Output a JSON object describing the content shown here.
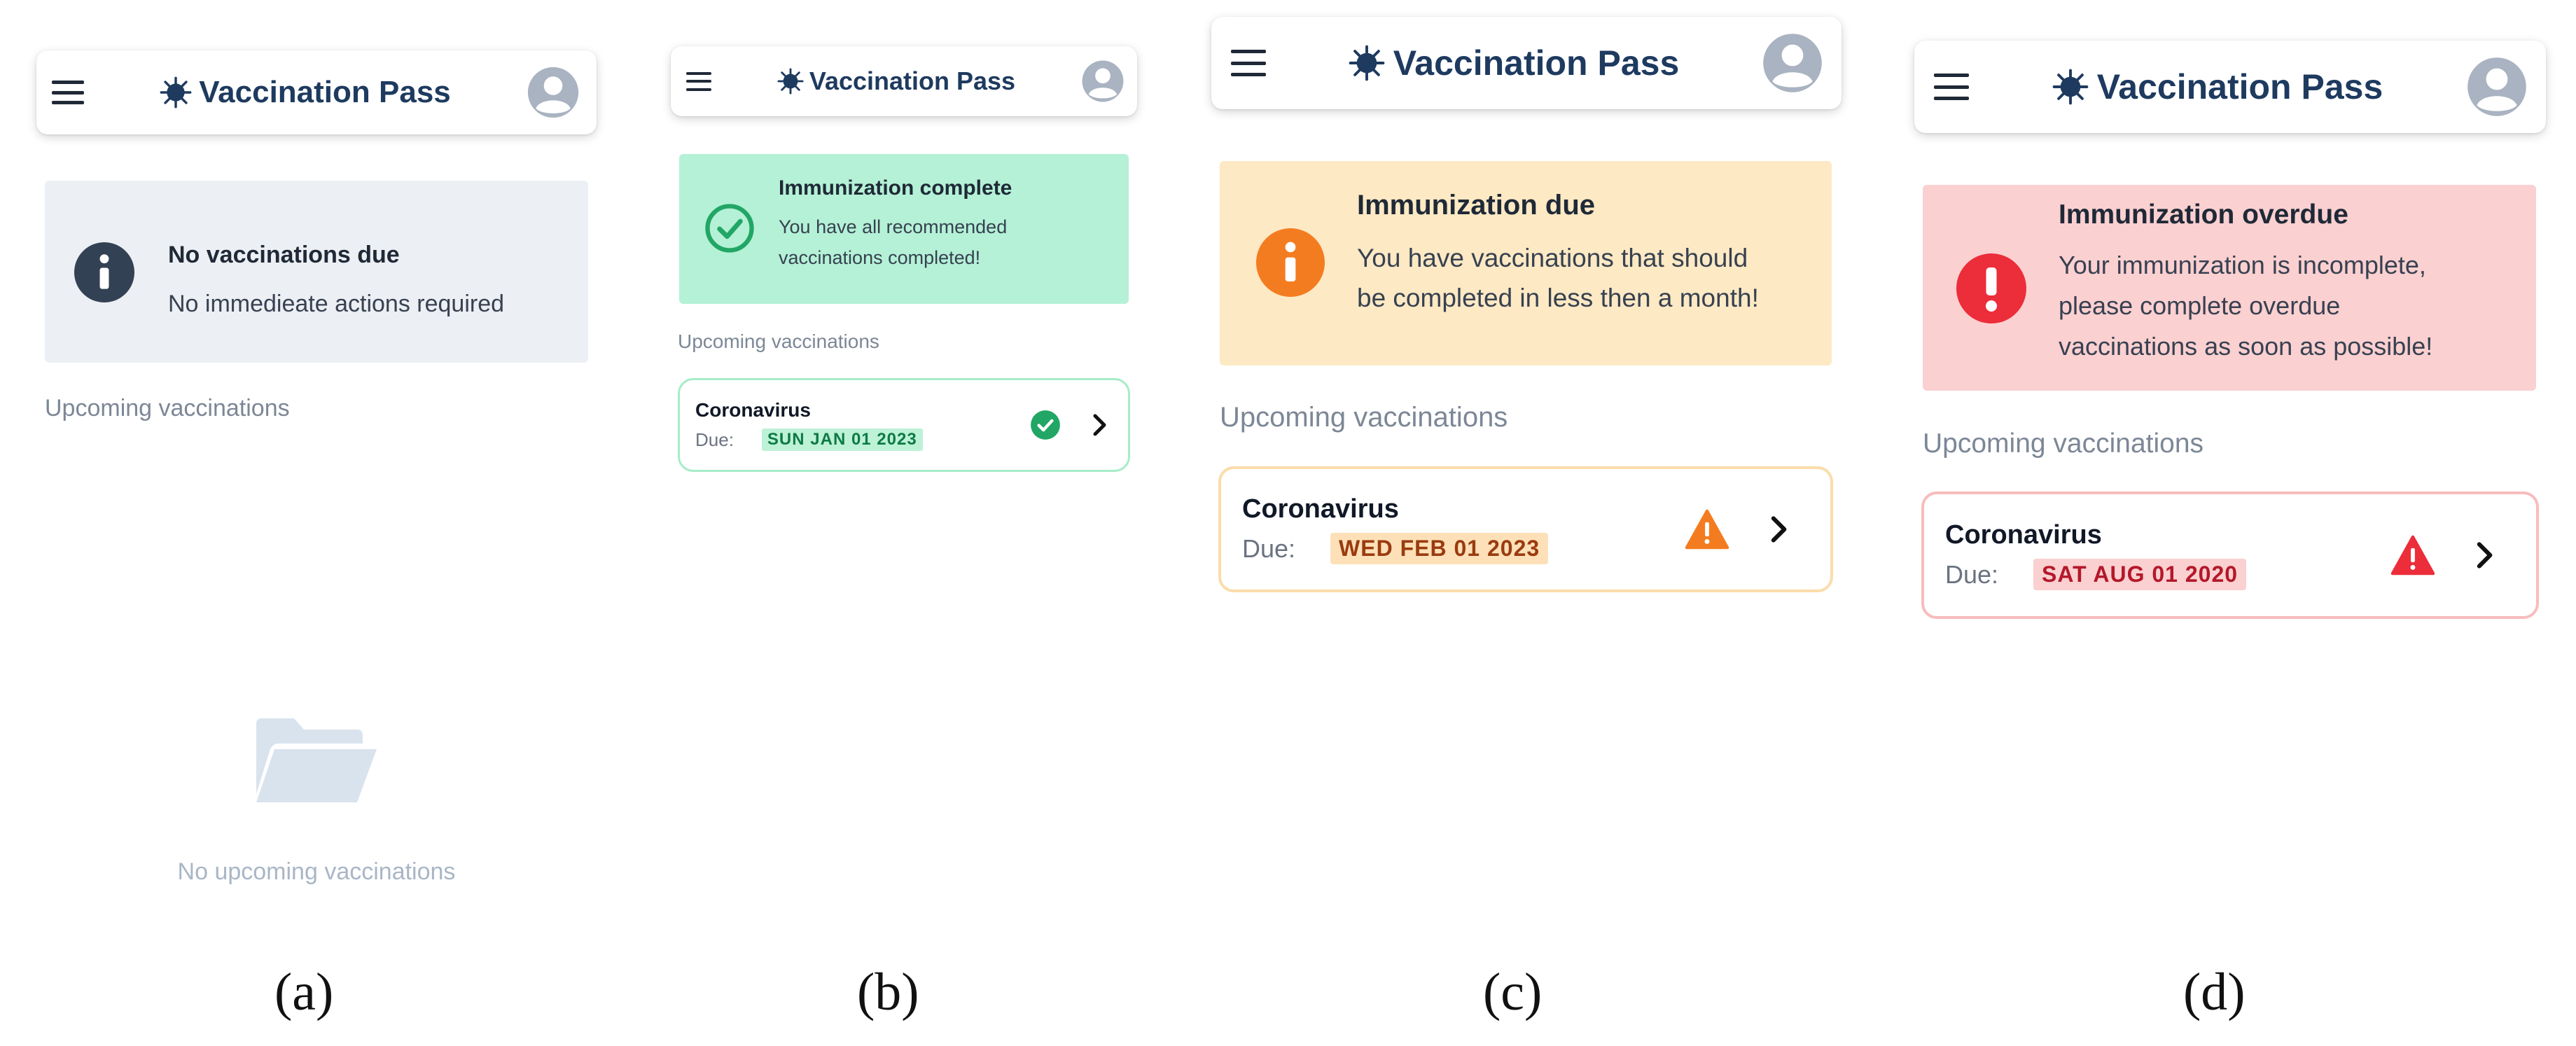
{
  "app": {
    "title": "Vaccination Pass"
  },
  "icons": {
    "menu": "hamburger-menu-icon",
    "brand": "virus-icon",
    "profile": "user-avatar-icon",
    "info": "info-icon",
    "success": "check-circle-icon",
    "warning": "warning-triangle-icon",
    "error": "exclamation-circle-icon",
    "chevron": "chevron-right-icon",
    "empty": "folder-open-icon"
  },
  "colors": {
    "brand": "#1e3a5f",
    "neutral_banner": "#eceff3",
    "success_banner": "#b4f1d6",
    "warning_banner": "#fde9c4",
    "error_banner": "#fbd0d0",
    "success": "#22a665",
    "warning": "#f47c20",
    "error": "#ec2d3a"
  },
  "panels": [
    {
      "caption": "(a)",
      "banner": {
        "title": "No vaccinations due",
        "body": [
          "No immedieate actions required"
        ]
      },
      "section_title": "Upcoming vaccinations",
      "empty_state": "No upcoming vaccinations"
    },
    {
      "caption": "(b)",
      "banner": {
        "title": "Immunization complete",
        "body": [
          "You have all recommended",
          "vaccinations completed!"
        ]
      },
      "section_title": "Upcoming vaccinations",
      "card": {
        "name": "Coronavirus",
        "due_label": "Due:",
        "date": "SUN JAN 01 2023",
        "status": "complete"
      }
    },
    {
      "caption": "(c)",
      "banner": {
        "title": "Immunization due",
        "body": [
          "You have vaccinations that should",
          "be completed in less then a month!"
        ]
      },
      "section_title": "Upcoming vaccinations",
      "card": {
        "name": "Coronavirus",
        "due_label": "Due:",
        "date": "WED FEB 01 2023",
        "status": "due"
      }
    },
    {
      "caption": "(d)",
      "banner": {
        "title": "Immunization overdue",
        "body": [
          "Your immunization is incomplete,",
          "please complete overdue",
          "vaccinations as soon as possible!"
        ]
      },
      "section_title": "Upcoming vaccinations",
      "card": {
        "name": "Coronavirus",
        "due_label": "Due:",
        "date": "SAT AUG 01 2020",
        "status": "overdue"
      }
    }
  ]
}
